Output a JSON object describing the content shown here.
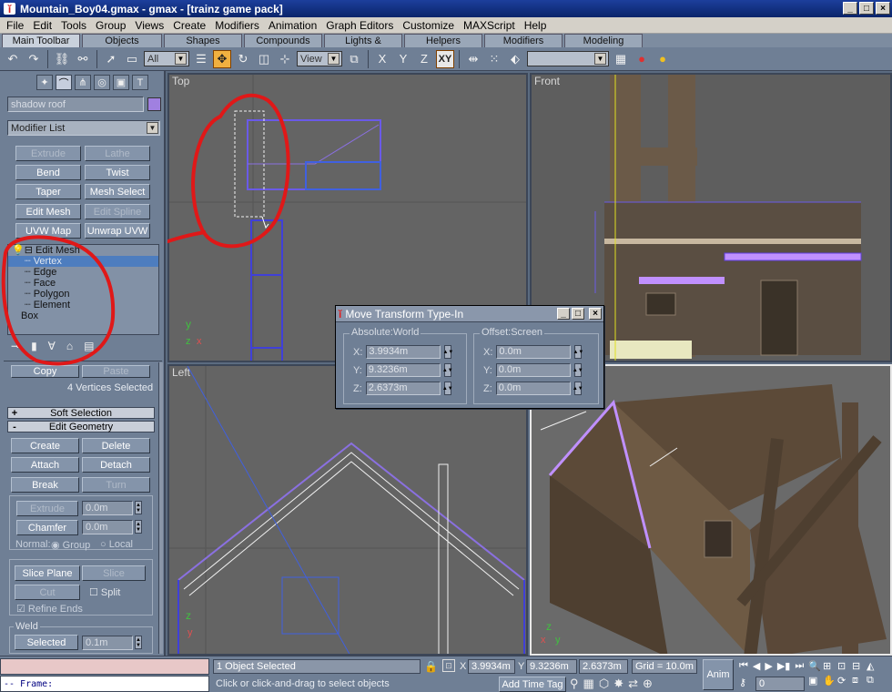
{
  "window": {
    "title": "Mountain_Boy04.gmax - gmax - [trainz game pack]"
  },
  "menu": [
    "File",
    "Edit",
    "Tools",
    "Group",
    "Views",
    "Create",
    "Modifiers",
    "Animation",
    "Graph Editors",
    "Customize",
    "MAXScript",
    "Help"
  ],
  "tabs": [
    "Main Toolbar",
    "Objects",
    "Shapes",
    "Compounds",
    "Lights & Cameras",
    "Helpers",
    "Modifiers",
    "Modeling"
  ],
  "toolbar": {
    "filter_value": "All",
    "coord_value": "View",
    "axis_x": "X",
    "axis_y": "Y",
    "axis_z": "Z",
    "axis_xy": "XY"
  },
  "panel": {
    "object_name": "shadow roof",
    "modifier_list": "Modifier List",
    "mod_buttons": [
      "Extrude",
      "Lathe",
      "Bend",
      "Twist",
      "Taper",
      "Mesh Select",
      "Edit Mesh",
      "Edit Spline",
      "UVW Map",
      "Unwrap UVW"
    ],
    "stack": [
      "Edit Mesh",
      "Vertex",
      "Edge",
      "Face",
      "Polygon",
      "Element",
      "Box"
    ],
    "copy": "Copy",
    "paste": "Paste",
    "selection_info": "4 Vertices Selected",
    "soft_selection": "Soft Selection",
    "edit_geometry": "Edit Geometry",
    "geom_buttons": [
      "Create",
      "Delete",
      "Attach",
      "Detach",
      "Break",
      "Turn"
    ],
    "extrude": "Extrude",
    "extrude_val": "0.0m",
    "chamfer": "Chamfer",
    "chamfer_val": "0.0m",
    "normal_label": "Normal:",
    "group_label": "Group",
    "local_label": "Local",
    "slice_plane": "Slice Plane",
    "slice": "Slice",
    "cut": "Cut",
    "split": "Split",
    "refine_ends": "Refine Ends",
    "weld": "Weld",
    "selected": "Selected",
    "weld_val": "0.1m",
    "plusminus": {
      "soft": "+",
      "edit": "-"
    }
  },
  "viewports": {
    "top": "Top",
    "front": "Front",
    "left": "Left",
    "perspective": ""
  },
  "dialog": {
    "title": "Move Transform Type-In",
    "absolute": "Absolute:World",
    "offset": "Offset:Screen",
    "abs_x": "3.9934m",
    "abs_y": "9.3236m",
    "abs_z": "2.6373m",
    "off_x": "0.0m",
    "off_y": "0.0m",
    "off_z": "0.0m",
    "lx": "X:",
    "ly": "Y:",
    "lz": "Z:"
  },
  "status": {
    "frame": "-- Frame:",
    "selected": "1 Object Selected",
    "prompt": "Click or click-and-drag to select objects",
    "x": "3.9934m",
    "y": "9.3236m",
    "z": "2.6373m",
    "grid": "Grid = 10.0m",
    "add_time_tag": "Add Time Tag",
    "anim": "Anim",
    "frame_val": "0",
    "lx": "X",
    "ly": "Y"
  }
}
